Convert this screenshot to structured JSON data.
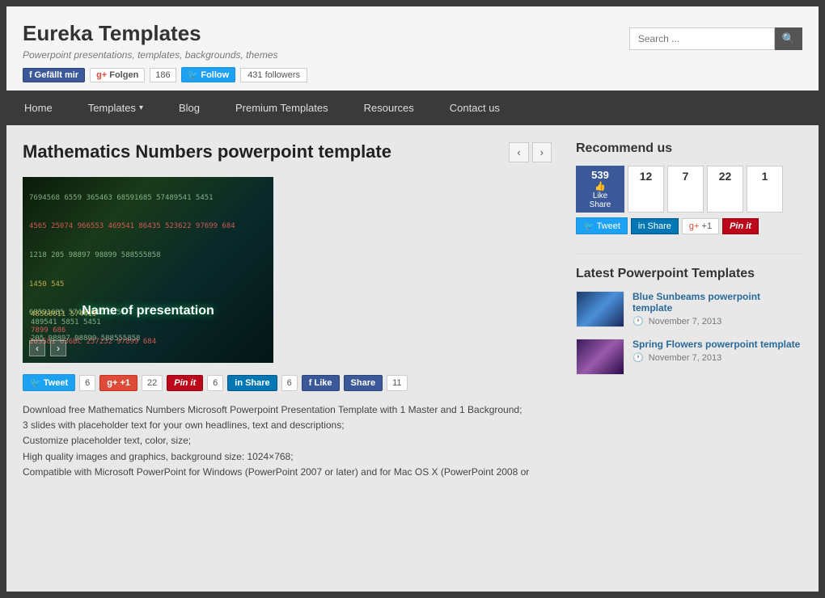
{
  "site": {
    "title": "Eureka Templates",
    "subtitle": "Powerpoint presentations, templates, backgrounds, themes",
    "search_placeholder": "Search ..."
  },
  "social": {
    "fb_label": "Gefällt mir",
    "gplus_label": "Folgen",
    "gplus_count": "186",
    "twitter_label": "Follow",
    "twitter_count": "431 followers"
  },
  "nav": {
    "items": [
      {
        "label": "Home",
        "id": "home"
      },
      {
        "label": "Templates",
        "id": "templates",
        "has_dropdown": true
      },
      {
        "label": "Blog",
        "id": "blog"
      },
      {
        "label": "Premium Templates",
        "id": "premium"
      },
      {
        "label": "Resources",
        "id": "resources"
      },
      {
        "label": "Contact us",
        "id": "contact"
      }
    ]
  },
  "article": {
    "title": "Mathematics Numbers powerpoint template",
    "slide_center_text": "Name of presentation",
    "slide_numbers_1": "7694568  6559  365463  68591685  57489541  5451",
    "slide_numbers_2": "4565  25074  966553  469541  86435  523622 97699  684",
    "slide_numbers_3": "1218  205  98897 98899  588555858",
    "slide_numbers_4": "1450  545",
    "slide_numbers_5": "68591685  57489541  5451",
    "slide_numbers_6": "265581  636BC 257232 97899  684",
    "slide_numbers_7": "48568011  574415",
    "slide_numbers_8": "489541  5851  5451",
    "slide_numbers_9": "7899  686",
    "slide_numbers_10": "205  98897 98899  588555858",
    "share_counts": {
      "tweet": "6",
      "gplus": "22",
      "pin": "6",
      "linkedin": "6",
      "fb_like": "11"
    },
    "description_1": "Download free Mathematics Numbers Microsoft Powerpoint Presentation Template with 1 Master and 1 Background;",
    "description_2": "3 slides with placeholder text for your own headlines, text and descriptions;",
    "description_3": "Customize placeholder text, color, size;",
    "description_4": "High quality images and graphics, background size: 1024×768;",
    "description_5": "Compatible with Microsoft PowerPoint for Windows (PowerPoint 2007 or later) and for Mac OS X (PowerPoint 2008 or"
  },
  "sidebar": {
    "recommend_title": "Recommend us",
    "fb_count": "539",
    "fb_like_label": "Like",
    "fb_share_label": "Share",
    "tw_count": "12",
    "li_count": "7",
    "gp_count": "22",
    "pin_count": "1",
    "tweet_label": "Tweet",
    "linkedin_label": "Share",
    "gplus_label": "+1",
    "pin_label": "Pin it",
    "latest_title": "Latest Powerpoint Templates",
    "latest_items": [
      {
        "name": "Blue Sunbeams powerpoint template",
        "date": "November 7, 2013",
        "thumb_class": "thumb-blue"
      },
      {
        "name": "Spring Flowers powerpoint template",
        "date": "November 7, 2013",
        "thumb_class": "thumb-purple"
      }
    ]
  }
}
